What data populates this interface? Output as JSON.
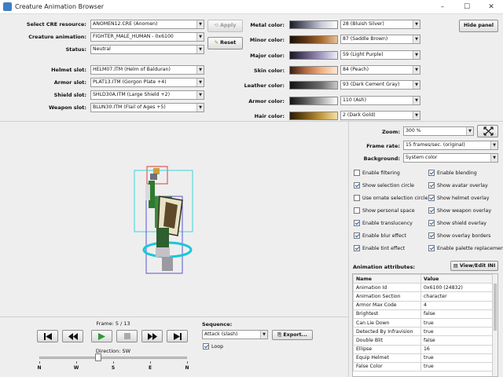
{
  "window": {
    "title": "Creature Animation Browser",
    "minimize": "–",
    "maximize": "☐",
    "close": "✕"
  },
  "left_form": [
    {
      "label": "Select CRE resource:",
      "value": "ANOMEN12.CRE (Anomen)"
    },
    {
      "label": "Creature animation:",
      "value": "FIGHTER_MALE_HUMAN - 0x6100"
    },
    {
      "label": "Status:",
      "value": "Neutral"
    },
    {
      "label": "Helmet slot:",
      "value": "HELM07.ITM (Helm of Balduran)"
    },
    {
      "label": "Armor slot:",
      "value": "PLAT13.ITM (Gorgon Plate +4)"
    },
    {
      "label": "Shield slot:",
      "value": "SHLD30A.ITM (Large Shield +2)"
    },
    {
      "label": "Weapon slot:",
      "value": "BLUN30.ITM (Flail of Ages +5)"
    }
  ],
  "buttons": {
    "apply": "Apply",
    "reset": "Reset",
    "hide_panel": "Hide panel"
  },
  "colors": [
    {
      "label": "Metal color:",
      "value": "28 (Bluish Silver)",
      "grad": [
        "#1a1c25",
        "#6d7182",
        "#c9ccd8",
        "#ffffff"
      ]
    },
    {
      "label": "Minor color:",
      "value": "87 (Saddle Brown)",
      "grad": [
        "#1b0f06",
        "#5c3514",
        "#a86b2e",
        "#e6c29a"
      ]
    },
    {
      "label": "Major color:",
      "value": "59 (Light Purple)",
      "grad": [
        "#1a1622",
        "#5e5478",
        "#a39bc2",
        "#f0edf8"
      ]
    },
    {
      "label": "Skin color:",
      "value": "84 (Peach)",
      "grad": [
        "#3b1e10",
        "#b46a40",
        "#f2b084",
        "#ffe9d6"
      ]
    },
    {
      "label": "Leather color:",
      "value": "93 (Dark Cement Gray)",
      "grad": [
        "#121212",
        "#3f3f40",
        "#6e6e70",
        "#c8c8c8"
      ]
    },
    {
      "label": "Armor color:",
      "value": "110 (Ash)",
      "grad": [
        "#141414",
        "#585858",
        "#adadad",
        "#ffffff"
      ]
    },
    {
      "label": "Hair color:",
      "value": "2 (Dark Gold)",
      "grad": [
        "#2a1a05",
        "#7a5416",
        "#c49a3e",
        "#f4dfa6"
      ]
    }
  ],
  "settings": {
    "zoom_label": "Zoom:",
    "zoom_value": "300 %",
    "frame_rate_label": "Frame rate:",
    "frame_rate_value": "15 frames/sec. (original)",
    "background_label": "Background:",
    "background_value": "System color"
  },
  "checkboxes_left": [
    {
      "label": "Enable filtering",
      "checked": false
    },
    {
      "label": "Show selection circle",
      "checked": true
    },
    {
      "label": "Use ornate selection circle",
      "checked": false
    },
    {
      "label": "Show personal space",
      "checked": false
    },
    {
      "label": "Enable translucency",
      "checked": true
    },
    {
      "label": "Enable blur effect",
      "checked": true
    },
    {
      "label": "Enable tint effect",
      "checked": true
    }
  ],
  "checkboxes_right": [
    {
      "label": "Enable blending",
      "checked": true
    },
    {
      "label": "Show avatar overlay",
      "checked": true
    },
    {
      "label": "Show helmet overlay",
      "checked": true
    },
    {
      "label": "Show weapon overlay",
      "checked": true
    },
    {
      "label": "Show shield overlay",
      "checked": true
    },
    {
      "label": "Show overlay borders",
      "checked": true
    },
    {
      "label": "Enable palette replacement",
      "checked": true
    }
  ],
  "attributes": {
    "heading": "Animation attributes:",
    "view_edit": "View/Edit INI",
    "columns": [
      "Name",
      "Value"
    ],
    "rows": [
      [
        "Animation Id",
        "0x6100 (24832)"
      ],
      [
        "Animation Section",
        "character"
      ],
      [
        "Armor Max Code",
        "4"
      ],
      [
        "Brightest",
        "false"
      ],
      [
        "Can Lie Down",
        "true"
      ],
      [
        "Detected By Infravision",
        "true"
      ],
      [
        "Double Blit",
        "false"
      ],
      [
        "Ellipse",
        "16"
      ],
      [
        "Equip Helmet",
        "true"
      ],
      [
        "False Color",
        "true"
      ]
    ]
  },
  "playback": {
    "frame_label": "Frame: 5 / 13",
    "direction_label": "Direction: SW",
    "ticks": [
      "N",
      "W",
      "S",
      "E",
      "N"
    ],
    "direction_fraction": 0.4
  },
  "sequence": {
    "label": "Sequence:",
    "value": "Attack (slash)",
    "loop_label": "Loop",
    "loop_checked": true,
    "export": "Export..."
  }
}
